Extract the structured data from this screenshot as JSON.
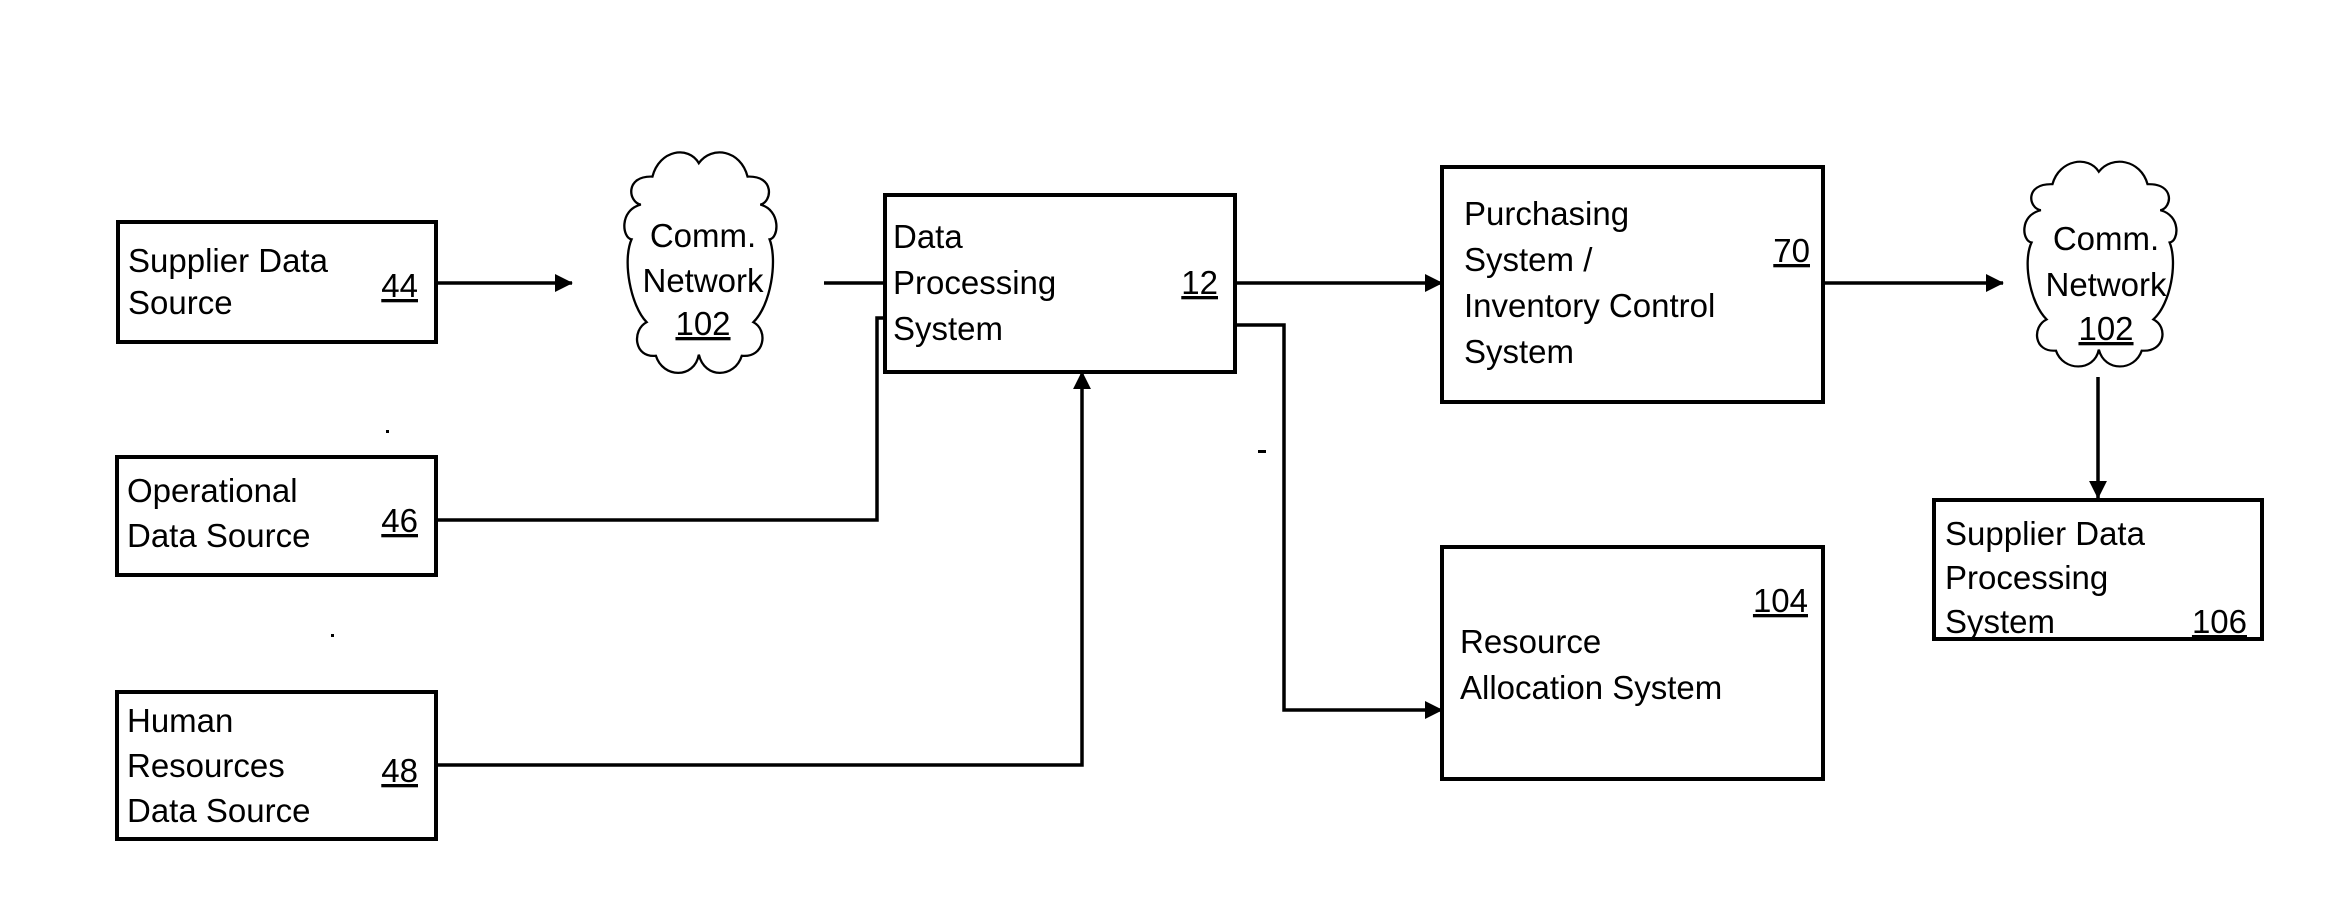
{
  "diagram": {
    "type": "block-diagram",
    "nodes": {
      "supplier_data_source": {
        "lines": [
          "Supplier Data",
          "Source"
        ],
        "ref": "44"
      },
      "comm_network_1": {
        "lines": [
          "Comm.",
          "Network"
        ],
        "ref": "102"
      },
      "operational_data_source": {
        "lines": [
          "Operational",
          "Data Source"
        ],
        "ref": "46"
      },
      "human_resources_data_source": {
        "lines": [
          "Human",
          "Resources",
          "Data Source"
        ],
        "ref": "48"
      },
      "data_processing_system": {
        "lines": [
          "Data",
          "Processing",
          "System"
        ],
        "ref": "12"
      },
      "purchasing_inventory_system": {
        "lines": [
          "Purchasing",
          "System /",
          "Inventory Control",
          "System"
        ],
        "ref": "70"
      },
      "resource_allocation_system": {
        "lines": [
          "Resource",
          "Allocation System"
        ],
        "ref": "104"
      },
      "comm_network_2": {
        "lines": [
          "Comm.",
          "Network"
        ],
        "ref": "102"
      },
      "supplier_data_processing_system": {
        "lines": [
          "Supplier Data",
          "Processing",
          "System"
        ],
        "ref": "106"
      }
    },
    "edges": [
      {
        "from": "supplier_data_source",
        "to": "comm_network_1"
      },
      {
        "from": "comm_network_1",
        "to": "data_processing_system"
      },
      {
        "from": "operational_data_source",
        "to": "data_processing_system"
      },
      {
        "from": "human_resources_data_source",
        "to": "data_processing_system"
      },
      {
        "from": "data_processing_system",
        "to": "purchasing_inventory_system"
      },
      {
        "from": "data_processing_system",
        "to": "resource_allocation_system"
      },
      {
        "from": "purchasing_inventory_system",
        "to": "comm_network_2"
      },
      {
        "from": "comm_network_2",
        "to": "supplier_data_processing_system"
      }
    ]
  }
}
